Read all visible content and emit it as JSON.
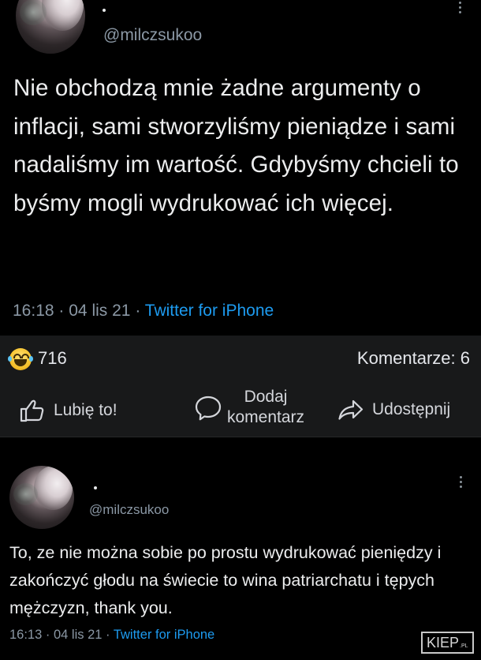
{
  "tweet1": {
    "handle": "@milczsukoo",
    "text": "Nie obchodzą mnie żadne argumenty o inflacji, sami stworzyliśmy pieniądze i sami nadaliśmy im wartość. Gdybyśmy chcieli to byśmy mogli wydrukować ich więcej.",
    "time": "16:18",
    "date": "04 lis 21",
    "source": "Twitter for iPhone",
    "separator": "·"
  },
  "facebook": {
    "reaction_icon": "laughing-emoji-icon",
    "reaction_count": "716",
    "comments_count": "Komentarze: 6",
    "like_label": "Lubię to!",
    "comment_label": "Dodaj komentarz",
    "share_label": "Udostępnij",
    "background_color": "#18191a"
  },
  "tweet2": {
    "handle": "@milczsukoo",
    "text": "To, ze nie można sobie po prostu wydrukować pieniędzy i zakończyć głodu na świecie to wina patriarchatu i tępych mężczyzn, thank you.",
    "time": "16:13",
    "date": "04 lis 21",
    "source": "Twitter for iPhone",
    "separator": "·"
  },
  "watermark": {
    "main": "KIEP",
    "suffix": ".PL"
  },
  "colors": {
    "link": "#1d9bf0",
    "muted": "#8b98a5",
    "background": "#000000"
  }
}
